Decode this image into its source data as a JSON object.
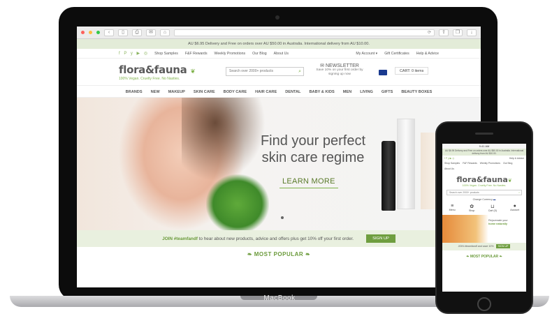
{
  "device_label": "MacBook",
  "browser": {
    "url_text": "⟳"
  },
  "site": {
    "promo_bar": "AU $6.95 Delivery and Free on orders over AU $50.00 in Australia. International delivery from AU $10.00.",
    "social_icons": "f P y ▶ ◎",
    "utility_links": [
      "Shop Samples",
      "F&F Rewards",
      "Weekly Promotions",
      "Our Blog",
      "About Us"
    ],
    "account_links": [
      "My Account ▾",
      "Gift Certificates",
      "Help & Advice"
    ],
    "logo": "flora&fauna",
    "tagline": "100% Vegan. Cruelty Free. No Nasties.",
    "search_placeholder": "Search over 2000+ products",
    "newsletter_title": "NEWSLETTER",
    "newsletter_desc": "Save 10% on your first order by signing up now",
    "cart_label": "CART: 0 items",
    "nav": [
      "BRANDS",
      "NEW",
      "MAKEUP",
      "SKIN CARE",
      "BODY CARE",
      "HAIR CARE",
      "DENTAL",
      "BABY & KIDS",
      "MEN",
      "LIVING",
      "GIFTS",
      "BEAUTY BOXES"
    ],
    "hero_title_1": "Find your perfect",
    "hero_title_2": "skin care regime",
    "hero_cta": "LEARN MORE",
    "join_hashtag": "JOIN #teamfandf",
    "join_text": "to hear about new products, advice and offers plus get 10% off your first order.",
    "signup_button": "SIGN UP",
    "most_popular": "MOST POPULAR"
  },
  "mobile": {
    "status": "9:41 AM",
    "promo": "AU $6.95 Delivery and Free on orders over AU $50.00 in Australia. International delivery from AU $10.00.",
    "help": "Help & Advice",
    "links": [
      "Shop Samples",
      "F&F Rewards",
      "Weekly Promotions",
      "Our Blog",
      "About Us"
    ],
    "logo": "flora&fauna",
    "tagline": "100% Vegan. Cruelty Free. No Nasties.",
    "search_placeholder": "Search over 2000+ products",
    "currency": "Change Currency",
    "icons": [
      {
        "label": "Menu",
        "glyph": "≡"
      },
      {
        "label": "Shop",
        "glyph": "✿"
      },
      {
        "label": "Cart (0)",
        "glyph": "🛒"
      },
      {
        "label": "Account",
        "glyph": "●"
      }
    ],
    "hero_text_1": "Rejuvenate your",
    "hero_text_2": "home naturally",
    "join_text": "JOIN #teamfandf and save 10%",
    "signup": "SIGN UP",
    "most_popular": "MOST POPULAR"
  }
}
